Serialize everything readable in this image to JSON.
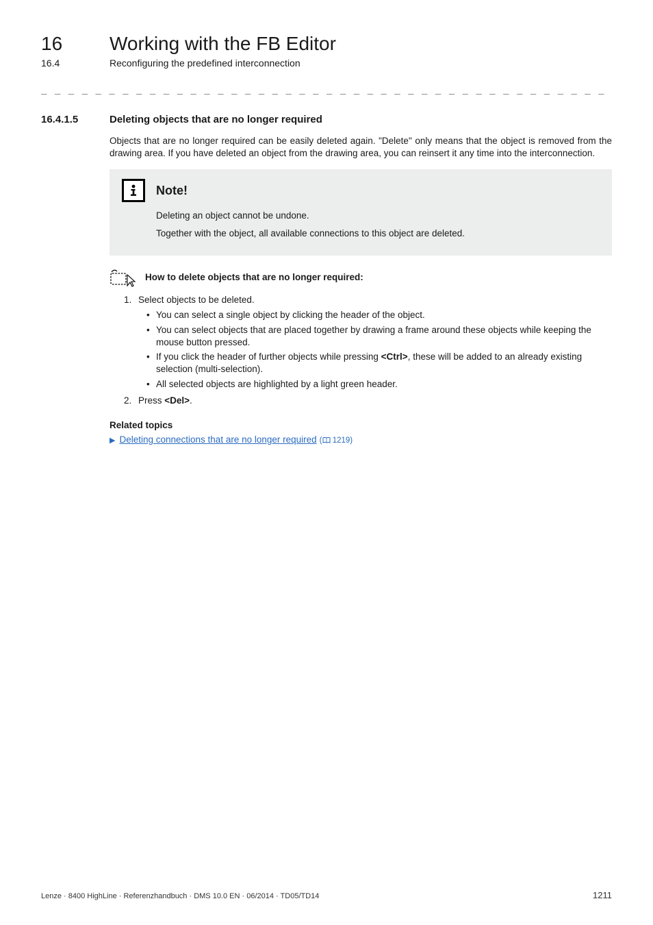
{
  "running_head": {
    "chapter_number": "16",
    "chapter_title": "Working with the FB Editor",
    "section_number": "16.4",
    "section_title": "Reconfiguring the predefined interconnection"
  },
  "dash_rule": "_ _ _ _ _ _ _ _ _ _ _ _ _ _ _ _ _ _ _ _ _ _ _ _ _ _ _ _ _ _ _ _ _ _ _ _ _ _ _ _ _ _ _ _ _ _ _ _ _ _ _ _ _ _ _ _ _ _ _ _ _ _ _ _",
  "section": {
    "number": "16.4.1.5",
    "title": "Deleting objects that are no longer required",
    "intro": "Objects that are no longer required can be easily deleted again. \"Delete\" only means that the object is removed from the drawing area. If you have deleted an object from the drawing area, you can reinsert it any time into the interconnection."
  },
  "note": {
    "title": "Note!",
    "lines": [
      "Deleting an object cannot be undone.",
      "Together with the object, all available connections to this object are deleted."
    ]
  },
  "howto": {
    "title": "How to delete objects that are no longer required:",
    "steps": [
      {
        "text": "Select objects to be deleted.",
        "sub": [
          "You can select a single object by clicking the header of the object.",
          "You can select objects that are placed together by drawing a frame around these objects while keeping the mouse button pressed.",
          "If you click the header of further objects while pressing <Ctrl>, these will be added to an already existing selection (multi-selection).",
          "All selected objects are highlighted by a light green header."
        ]
      },
      {
        "text": "Press <Del>.",
        "sub": []
      }
    ]
  },
  "related": {
    "heading": "Related topics",
    "link_text": "Deleting connections that are no longer required",
    "link_page_prefix": "(",
    "link_page": "1219",
    "link_page_suffix": ")"
  },
  "footer": {
    "left": "Lenze · 8400 HighLine · Referenzhandbuch · DMS 10.0 EN · 06/2014 · TD05/TD14",
    "right": "1211"
  }
}
